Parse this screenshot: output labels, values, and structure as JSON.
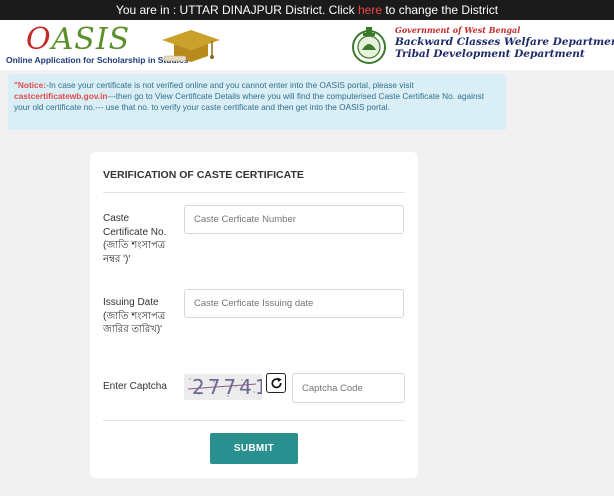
{
  "topbar": {
    "prefix": "You are in : ",
    "district": "UTTAR DINAJPUR District",
    "click": ". Click ",
    "here_link": "here",
    "suffix": " to change the District"
  },
  "header": {
    "logo_text_first": "O",
    "logo_text_rest": "ASIS",
    "logo_subtitle": "Online Application for Scholarship in Studies",
    "gov_line1": "Government of West Bengal",
    "gov_line2": "Backward Classes Welfare Department",
    "gov_line3": "Tribal Development Department"
  },
  "notice": {
    "label": "\"Notice:",
    "text1": "-In case your certificate is not verified online and you cannot enter into the OASIS portal, please visit ",
    "link": "castcertificatewb.gov.in",
    "text2": "---then go to View Certificate Details where you will find the computerised Caste Certificate No. against your old certificate no.--- use that no. to verify your caste certificate and then get into the OASIS portal."
  },
  "form": {
    "title": "VERIFICATION OF CASTE CERTIFICATE",
    "cert_no_label": "Caste Certificate No. (জাতি শংসাপত্র নম্বর ')'",
    "cert_no_placeholder": "Caste Cerficate Number",
    "issue_date_label": "Issuing Date (জাতি শংসাপত্র জারির তারিখ)'",
    "issue_date_placeholder": "Caste Cerficate Issuing date",
    "captcha_label": "Enter Captcha",
    "captcha_text": "27741",
    "captcha_placeholder": "Captcha Code",
    "submit_label": "SUBMIT"
  },
  "colors": {
    "topbar_bg": "#1b1b1b",
    "link_red": "#f04646",
    "notice_bg": "#d9eef5",
    "submit_bg": "#2a8f8f"
  },
  "icons": {
    "refresh": "refresh-icon",
    "graduation": "graduation-cap-icon",
    "emblem": "west-bengal-emblem-icon"
  }
}
